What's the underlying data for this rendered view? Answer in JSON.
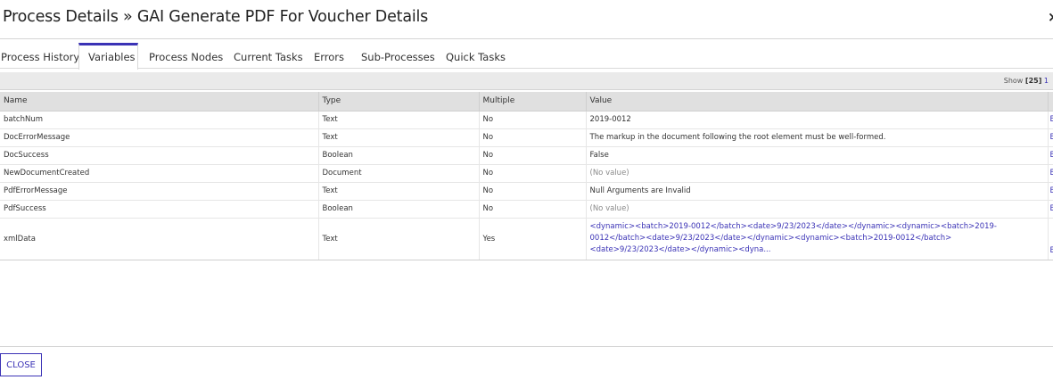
{
  "dialog": {
    "title": "Process Details » GAI Generate PDF For Voucher Details",
    "close_icon": "×"
  },
  "tabs": [
    {
      "label": "Process History"
    },
    {
      "label": "Variables",
      "active": true
    },
    {
      "label": "Process Nodes"
    },
    {
      "label": "Current Tasks"
    },
    {
      "label": "Errors"
    },
    {
      "label": "Sub-Processes"
    },
    {
      "label": "Quick Tasks"
    }
  ],
  "pager": {
    "show_label": "Show",
    "page_size": "[25]",
    "page_indicator": "1"
  },
  "table": {
    "columns": [
      "Name",
      "Type",
      "Multiple",
      "Value"
    ],
    "edit_label": "E",
    "rows": [
      {
        "name": "batchNum",
        "type": "Text",
        "multiple": "No",
        "value": "2019-0012"
      },
      {
        "name": "DocErrorMessage",
        "type": "Text",
        "multiple": "No",
        "value": "The markup in the document following the root element must be well-formed."
      },
      {
        "name": "DocSuccess",
        "type": "Boolean",
        "multiple": "No",
        "value": "False"
      },
      {
        "name": "NewDocumentCreated",
        "type": "Document",
        "multiple": "No",
        "value": "(No value)"
      },
      {
        "name": "PdfErrorMessage",
        "type": "Text",
        "multiple": "No",
        "value": "Null Arguments are Invalid"
      },
      {
        "name": "PdfSuccess",
        "type": "Boolean",
        "multiple": "No",
        "value": "(No value)"
      },
      {
        "name": "xmlData",
        "type": "Text",
        "multiple": "Yes",
        "value": "<dynamic><batch>2019-0012</batch><date>9/23/2023</date></dynamic><dynamic><batch>2019-0012</batch><date>9/23/2023</date></dynamic><dynamic><batch>2019-0012</batch><date>9/23/2023</date></dynamic><dyna..."
      }
    ]
  },
  "footer": {
    "close_label": "CLOSE"
  },
  "colors": {
    "accent": "#3b33b6",
    "header_bg": "#e0e0e0"
  }
}
